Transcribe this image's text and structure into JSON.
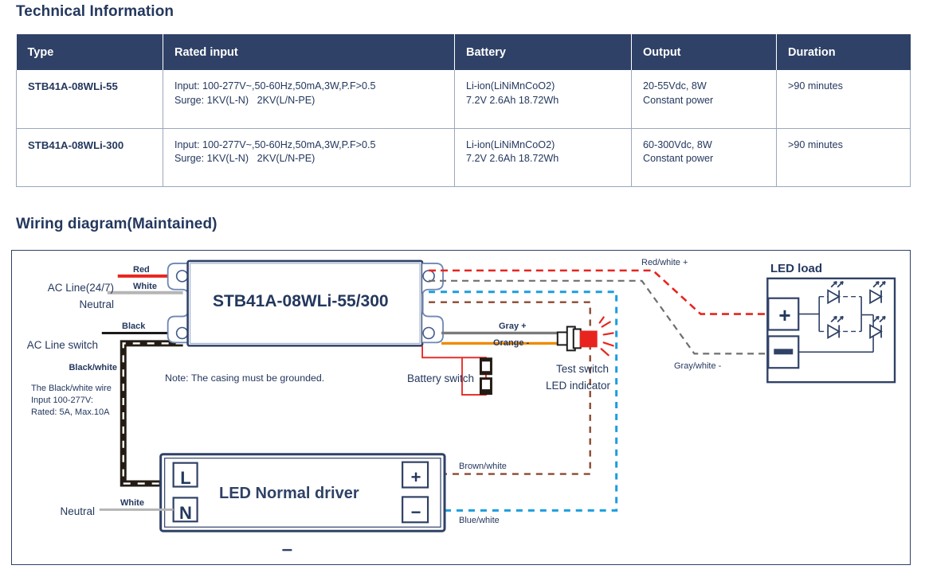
{
  "sections": {
    "technical_title": "Technical Information",
    "wiring_title": "Wiring diagram(Maintained)"
  },
  "table": {
    "columns": [
      "Type",
      "Rated input",
      "Battery",
      "Output",
      "Duration"
    ],
    "rows": [
      {
        "type": "STB41A-08WLi-55",
        "rated_input_1": "Input: 100-277V~,50-60Hz,50mA,3W,P.F>0.5",
        "rated_input_2": "Surge: 1KV(L-N)   2KV(L/N-PE)",
        "battery_1": "Li-ion(LiNiMnCoO2)",
        "battery_2": "7.2V 2.6Ah 18.72Wh",
        "output_1": "20-55Vdc, 8W",
        "output_2": "Constant power",
        "duration": ">90 minutes"
      },
      {
        "type": "STB41A-08WLi-300",
        "rated_input_1": "Input: 100-277V~,50-60Hz,50mA,3W,P.F>0.5",
        "rated_input_2": "Surge: 1KV(L-N)   2KV(L/N-PE)",
        "battery_1": "Li-ion(LiNiMnCoO2)",
        "battery_2": "7.2V 2.6Ah 18.72Wh",
        "output_1": "60-300Vdc, 8W",
        "output_2": "Constant power",
        "duration": ">90 minutes"
      }
    ]
  },
  "diagram": {
    "emergency_unit_label": "STB41A-08WLi-55/300",
    "driver_label": "LED Normal driver",
    "led_load_label": "LED load",
    "note": "Note: The casing must be grounded.",
    "terminals": {
      "driver_l": "L",
      "driver_n": "N",
      "driver_plus": "+",
      "driver_minus": "−",
      "load_plus": "+",
      "load_minus": "—"
    },
    "labels": {
      "ac_line_247": "AC Line(24/7)",
      "neutral_top": "Neutral",
      "ac_line_switch": "AC Line switch",
      "wire_red": "Red",
      "wire_white_top": "White",
      "wire_black": "Black",
      "black_white": "Black/white",
      "black_white_note_1": "The Black/white wire",
      "black_white_note_2": "Input 100-277V:",
      "black_white_note_3": "Rated: 5A, Max.10A",
      "neutral_bottom": "Neutral",
      "wire_white_bottom": "White",
      "gray_plus": "Gray +",
      "orange_minus": "Orange -",
      "battery_switch": "Battery switch",
      "test_switch_1": "Test switch",
      "test_switch_2": "LED indicator",
      "red_white_plus": "Red/white +",
      "gray_white_minus": "Gray/white -",
      "brown_white": "Brown/white",
      "blue_white": "Blue/white"
    }
  },
  "colors": {
    "header_bg": "#2f4166",
    "text_navy": "#24385e",
    "wire_red": "#e8241f",
    "wire_white_gray": "#b5b5b5",
    "wire_black": "#1a1a1a",
    "wire_gray": "#7a7a7a",
    "wire_orange": "#f08a00",
    "wire_blue": "#1a9ede",
    "wire_brown": "#8a4a32",
    "led_red": "#e8241f",
    "table_border": "#9aa7bd"
  }
}
